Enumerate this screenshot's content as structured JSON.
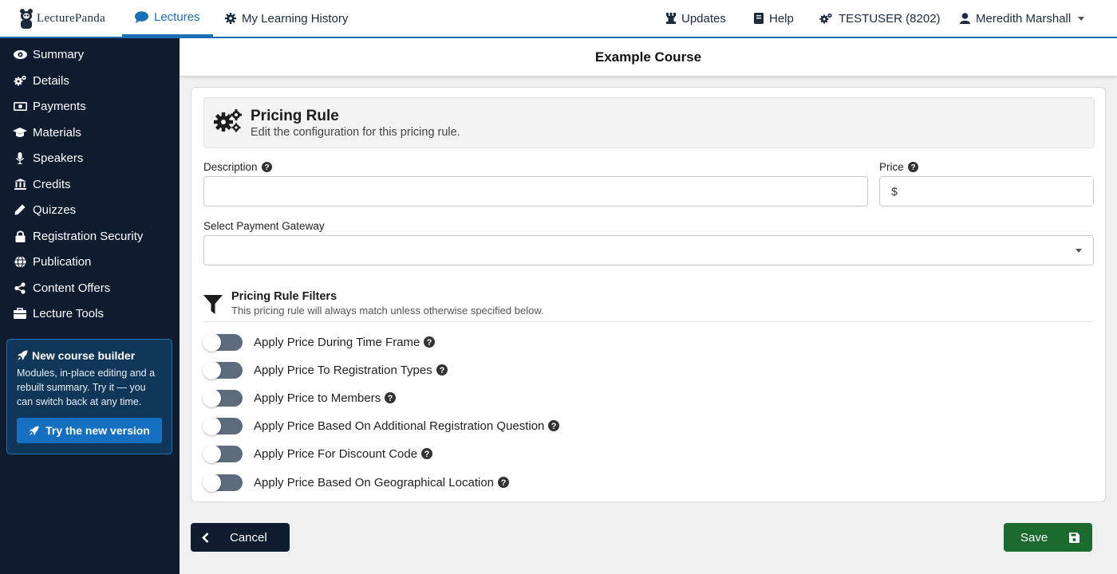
{
  "header": {
    "logo_text": "LecturePanda",
    "nav_left": [
      {
        "label": "Lectures",
        "icon": "comment-icon",
        "active": true
      },
      {
        "label": "My Learning History",
        "icon": "gear-icon",
        "active": false
      }
    ],
    "nav_right": [
      {
        "label": "Updates",
        "icon": "chess-rook-icon"
      },
      {
        "label": "Help",
        "icon": "book-icon"
      },
      {
        "label": "TESTUSER (8202)",
        "icon": "cogs-icon"
      },
      {
        "label": "Meredith Marshall",
        "icon": "user-icon"
      }
    ]
  },
  "sidebar": {
    "items": [
      {
        "label": "Summary",
        "icon": "eye-icon"
      },
      {
        "label": "Details",
        "icon": "cogs-icon"
      },
      {
        "label": "Payments",
        "icon": "money-icon"
      },
      {
        "label": "Materials",
        "icon": "graduation-cap-icon"
      },
      {
        "label": "Speakers",
        "icon": "microphone-icon"
      },
      {
        "label": "Credits",
        "icon": "university-icon"
      },
      {
        "label": "Quizzes",
        "icon": "pencil-icon"
      },
      {
        "label": "Registration Security",
        "icon": "lock-icon"
      },
      {
        "label": "Publication",
        "icon": "globe-icon"
      },
      {
        "label": "Content Offers",
        "icon": "share-icon"
      },
      {
        "label": "Lecture Tools",
        "icon": "toolbox-icon"
      }
    ],
    "promo": {
      "title": "New course builder",
      "text": "Modules, in-place editing and a rebuilt summary. Try it — you can switch back at any time.",
      "button_label": "Try the new version"
    }
  },
  "course_title": "Example Course",
  "pricing_rule": {
    "title": "Pricing Rule",
    "subtitle": "Edit the configuration for this pricing rule.",
    "description_label": "Description",
    "description_value": "",
    "price_label": "Price",
    "price_prefix": "$",
    "price_value": "",
    "gateway_label": "Select Payment Gateway",
    "gateway_value": ""
  },
  "filters": {
    "title": "Pricing Rule Filters",
    "subtitle": "This pricing rule will always match unless otherwise specified below.",
    "toggles": [
      {
        "label": "Apply Price During Time Frame",
        "on": false
      },
      {
        "label": "Apply Price To Registration Types",
        "on": false
      },
      {
        "label": "Apply Price to Members",
        "on": false
      },
      {
        "label": "Apply Price Based On Additional Registration Question",
        "on": false
      },
      {
        "label": "Apply Price For Discount Code",
        "on": false
      },
      {
        "label": "Apply Price Based On Geographical Location",
        "on": false
      }
    ]
  },
  "actions": {
    "cancel_label": "Cancel",
    "save_label": "Save"
  },
  "colors": {
    "primary": "#1a6fb5",
    "sidebar_bg": "#0f1c30",
    "save_green": "#1c6b2e",
    "toggle_off": "#5e6b7c"
  }
}
